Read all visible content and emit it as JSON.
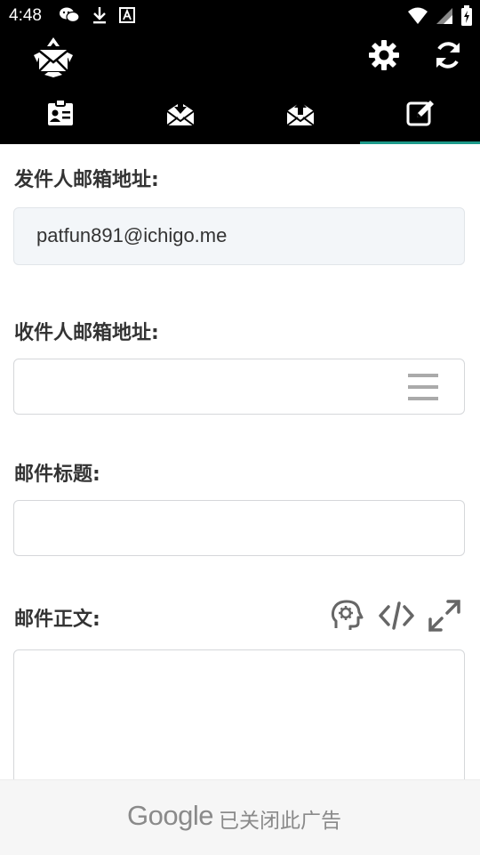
{
  "status_bar": {
    "time": "4:48",
    "left_icons": [
      "wechat-icon",
      "download-icon",
      "a-icon"
    ],
    "right_icons": [
      "wifi-icon",
      "signal-icon",
      "battery-icon"
    ]
  },
  "app_bar": {
    "logo": "recycle-mail-logo",
    "actions": [
      "gear-icon",
      "refresh-icon"
    ]
  },
  "tabs": [
    {
      "icon": "contact-card-icon",
      "active": false
    },
    {
      "icon": "inbox-download-icon",
      "active": false
    },
    {
      "icon": "outbox-upload-icon",
      "active": false
    },
    {
      "icon": "compose-icon",
      "active": true
    }
  ],
  "form": {
    "sender_label": "发件人邮箱地址:",
    "sender_value": "patfun891@ichigo.me",
    "recipient_label": "收件人邮箱地址:",
    "recipient_value": "",
    "subject_label": "邮件标题:",
    "subject_value": "",
    "body_label": "邮件正文:",
    "body_value": ""
  },
  "ad": {
    "brand": "Google",
    "text": "已关闭此广告"
  },
  "colors": {
    "accent": "#1d9a8a",
    "bar_bg": "#000000",
    "icon_gray": "#666666"
  }
}
